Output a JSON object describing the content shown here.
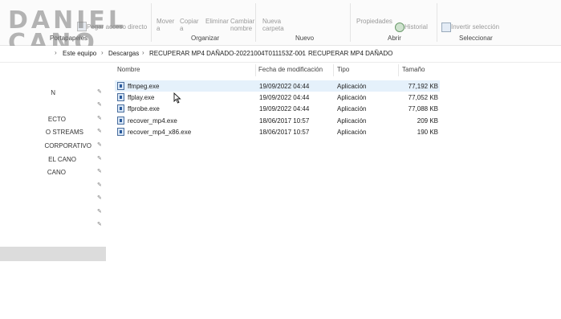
{
  "watermark": {
    "line1": "DANIEL",
    "line2": "CANO"
  },
  "ribbon": {
    "items": [
      {
        "label": "Pegar acceso directo"
      },
      {
        "label": "Mover a"
      },
      {
        "label": "Copiar a"
      },
      {
        "label": "Eliminar"
      },
      {
        "label": "Cambiar nombre"
      },
      {
        "label": "Nueva carpeta"
      },
      {
        "label": "Propiedades"
      },
      {
        "label": "Historial"
      },
      {
        "label": "Invertir selección"
      }
    ],
    "groups": [
      "Portapapeles",
      "Organizar",
      "Nuevo",
      "Abrir",
      "Seleccionar"
    ]
  },
  "address": {
    "crumbs": [
      "Este equipo",
      "Descargas",
      "RECUPERAR MP4 DAÑADO-20221004T011153Z-001",
      "RECUPERAR MP4 DAÑADO"
    ]
  },
  "nav": {
    "items": [
      "N",
      "ECTO",
      "O STREAMS",
      "CORPORATIVO",
      "EL CANO",
      "CANO"
    ]
  },
  "columns": {
    "name": "Nombre",
    "date": "Fecha de modificación",
    "type": "Tipo",
    "size": "Tamaño"
  },
  "files": [
    {
      "name": "ffmpeg.exe",
      "date": "19/09/2022 04:44",
      "type": "Aplicación",
      "size": "77,192 KB"
    },
    {
      "name": "ffplay.exe",
      "date": "19/09/2022 04:44",
      "type": "Aplicación",
      "size": "77,052 KB"
    },
    {
      "name": "ffprobe.exe",
      "date": "19/09/2022 04:44",
      "type": "Aplicación",
      "size": "77,088 KB"
    },
    {
      "name": "recover_mp4.exe",
      "date": "18/06/2017 10:57",
      "type": "Aplicación",
      "size": "209 KB"
    },
    {
      "name": "recover_mp4_x86.exe",
      "date": "18/06/2017 10:57",
      "type": "Aplicación",
      "size": "190 KB"
    }
  ]
}
